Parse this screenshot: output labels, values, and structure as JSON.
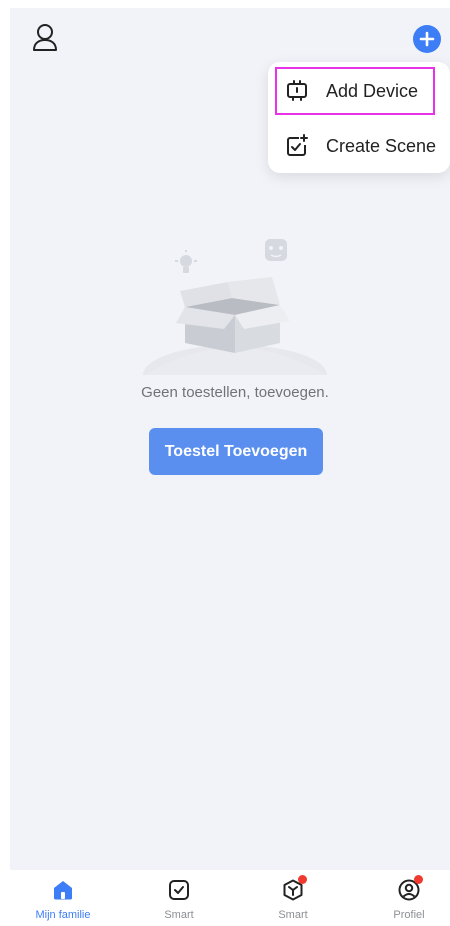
{
  "header": {
    "profile_icon": "person-outline-icon",
    "add_icon": "plus-circle-icon",
    "accent_color": "#3d7df5"
  },
  "menu": {
    "items": [
      {
        "label": "Add Device",
        "icon": "add-device-icon"
      },
      {
        "label": "Create Scene",
        "icon": "create-scene-icon"
      }
    ]
  },
  "empty_state": {
    "message": "Geen toestellen, toevoegen.",
    "button_label": "Toestel Toevoegen"
  },
  "bottom_nav": {
    "items": [
      {
        "label": "Mijn familie",
        "icon": "home-icon",
        "active": true
      },
      {
        "label": "Smart",
        "icon": "smart-checkbox-icon"
      },
      {
        "label": "Smart",
        "icon": "smart-cube-icon",
        "badge": true
      },
      {
        "label": "Profiel",
        "icon": "profile-icon",
        "badge": true
      }
    ]
  }
}
